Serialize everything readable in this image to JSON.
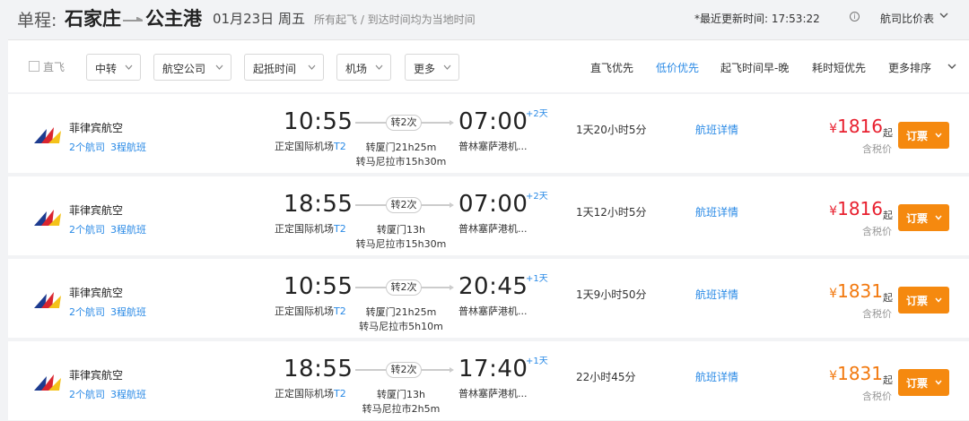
{
  "header": {
    "trip_type": "单程:",
    "from_city": "石家庄",
    "to_city": "公主港",
    "date": "01月23日 周五",
    "note": "所有起飞 / 到达时间均为当地时间",
    "updated": "*最近更新时间: 17:53:22",
    "info_icon": "i",
    "compare": "航司比价表"
  },
  "filters": {
    "direct_label": "直飞",
    "transfer": "中转",
    "airline": "航空公司",
    "time": "起抵时间",
    "airport": "机场",
    "more": "更多"
  },
  "sorts": {
    "direct_first": "直飞优先",
    "lowest_price": "低价优先",
    "early_to_late": "起飞时间早-晚",
    "shortest": "耗时短优先",
    "more_sort": "更多排序"
  },
  "colors": {
    "accent": "#2a8ae6",
    "price_red": "#e8202f",
    "price_orange": "#f2790f",
    "book": "#f5890f"
  },
  "flights": [
    {
      "airline": "菲律宾航空",
      "codeshare": "2个航司",
      "legs": "3程航班",
      "dep_time": "10:55",
      "dep_airport": "正定国际机场",
      "dep_terminal": "T2",
      "stops": "转2次",
      "via1": "转厦门21h25m",
      "via2": "转马尼拉市15h30m",
      "arr_time": "07:00",
      "arr_plus": "+2天",
      "arr_airport": "普林塞萨港机...",
      "duration": "1天20小时5分",
      "detail": "航班详情",
      "currency": "¥",
      "price": "1816",
      "price_suffix": "起",
      "tax": "含税价",
      "book": "订票"
    },
    {
      "airline": "菲律宾航空",
      "codeshare": "2个航司",
      "legs": "3程航班",
      "dep_time": "18:55",
      "dep_airport": "正定国际机场",
      "dep_terminal": "T2",
      "stops": "转2次",
      "via1": "转厦门13h",
      "via2": "转马尼拉市15h30m",
      "arr_time": "07:00",
      "arr_plus": "+2天",
      "arr_airport": "普林塞萨港机...",
      "duration": "1天12小时5分",
      "detail": "航班详情",
      "currency": "¥",
      "price": "1816",
      "price_suffix": "起",
      "tax": "含税价",
      "book": "订票"
    },
    {
      "airline": "菲律宾航空",
      "codeshare": "2个航司",
      "legs": "3程航班",
      "dep_time": "10:55",
      "dep_airport": "正定国际机场",
      "dep_terminal": "T2",
      "stops": "转2次",
      "via1": "转厦门21h25m",
      "via2": "转马尼拉市5h10m",
      "arr_time": "20:45",
      "arr_plus": "+1天",
      "arr_airport": "普林塞萨港机...",
      "duration": "1天9小时50分",
      "detail": "航班详情",
      "currency": "¥",
      "price": "1831",
      "price_suffix": "起",
      "tax": "含税价",
      "book": "订票"
    },
    {
      "airline": "菲律宾航空",
      "codeshare": "2个航司",
      "legs": "3程航班",
      "dep_time": "18:55",
      "dep_airport": "正定国际机场",
      "dep_terminal": "T2",
      "stops": "转2次",
      "via1": "转厦门13h",
      "via2": "转马尼拉市2h5m",
      "arr_time": "17:40",
      "arr_plus": "+1天",
      "arr_airport": "普林塞萨港机...",
      "duration": "22小时45分",
      "detail": "航班详情",
      "currency": "¥",
      "price": "1831",
      "price_suffix": "起",
      "tax": "含税价",
      "book": "订票"
    }
  ]
}
